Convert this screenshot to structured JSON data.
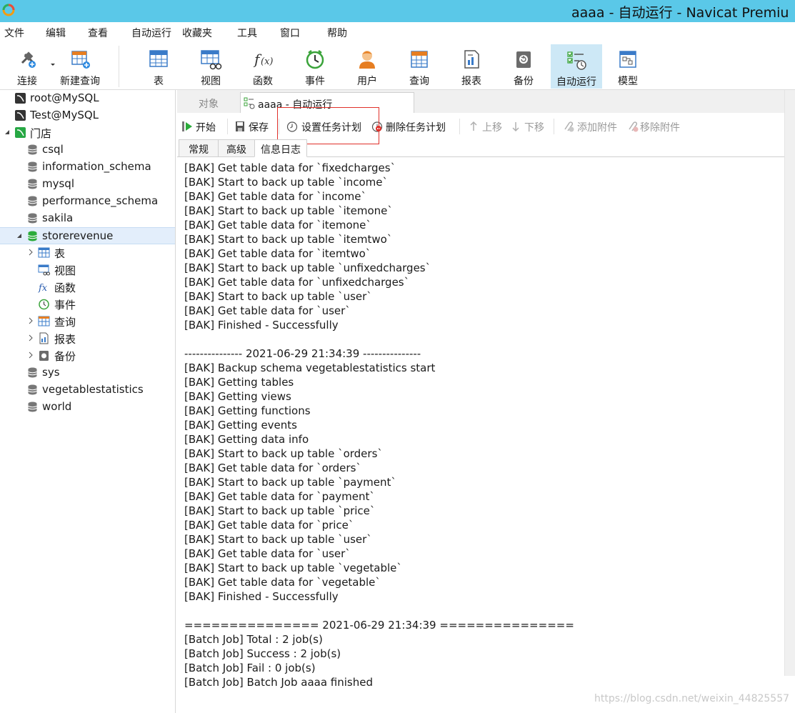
{
  "window": {
    "title": "aaaa - 自动运行 - Navicat Premiu"
  },
  "menu": [
    "文件",
    "编辑",
    "查看",
    "自动运行",
    "收藏夹",
    "工具",
    "窗口",
    "帮助"
  ],
  "toolbar": {
    "connect": "连接",
    "new_query": "新建查询",
    "table": "表",
    "view": "视图",
    "function": "函数",
    "event": "事件",
    "user": "用户",
    "query": "查询",
    "report": "报表",
    "backup": "备份",
    "automation": "自动运行",
    "model": "模型"
  },
  "sidebar": {
    "connections": [
      "root@MySQL",
      "Test@MySQL",
      "门店"
    ],
    "databases_before": [
      "csql",
      "information_schema",
      "mysql",
      "performance_schema",
      "sakila"
    ],
    "selected_db": "storerevenue",
    "db_children": [
      "表",
      "视图",
      "函数",
      "事件",
      "查询",
      "报表",
      "备份"
    ],
    "databases_after": [
      "sys",
      "vegetablestatistics",
      "world"
    ]
  },
  "tabs": {
    "objects": "对象",
    "active": "aaaa - 自动运行"
  },
  "actions": {
    "start": "开始",
    "save": "保存",
    "set_schedule": "设置任务计划",
    "delete_schedule": "删除任务计划",
    "move_up": "上移",
    "move_down": "下移",
    "add_attachment": "添加附件",
    "remove_attachment": "移除附件"
  },
  "subtabs": [
    "常规",
    "高级",
    "信息日志"
  ],
  "log_lines": [
    "[BAK] Get table data for `fixedcharges`",
    "[BAK] Start to back up table `income`",
    "[BAK] Get table data for `income`",
    "[BAK] Start to back up table `itemone`",
    "[BAK] Get table data for `itemone`",
    "[BAK] Start to back up table `itemtwo`",
    "[BAK] Get table data for `itemtwo`",
    "[BAK] Start to back up table `unfixedcharges`",
    "[BAK] Get table data for `unfixedcharges`",
    "[BAK] Start to back up table `user`",
    "[BAK] Get table data for `user`",
    "[BAK] Finished - Successfully",
    "",
    "--------------- 2021-06-29 21:34:39 ---------------",
    "[BAK] Backup schema vegetablestatistics start",
    "[BAK] Getting tables",
    "[BAK] Getting views",
    "[BAK] Getting functions",
    "[BAK] Getting events",
    "[BAK] Getting data info",
    "[BAK] Start to back up table `orders`",
    "[BAK] Get table data for `orders`",
    "[BAK] Start to back up table `payment`",
    "[BAK] Get table data for `payment`",
    "[BAK] Start to back up table `price`",
    "[BAK] Get table data for `price`",
    "[BAK] Start to back up table `user`",
    "[BAK] Get table data for `user`",
    "[BAK] Start to back up table `vegetable`",
    "[BAK] Get table data for `vegetable`",
    "[BAK] Finished - Successfully",
    "",
    "=============== 2021-06-29 21:34:39 ===============",
    "[Batch Job] Total : 2 job(s)",
    "[Batch Job] Success : 2 job(s)",
    "[Batch Job] Fail : 0 job(s)",
    "[Batch Job] Batch Job aaaa finished"
  ],
  "watermark": "https://blog.csdn.net/weixin_44825557",
  "colors": {
    "titlebar": "#5ac8e8",
    "selected_toolbar": "#cde8f6",
    "highlight": "#e0302a"
  }
}
